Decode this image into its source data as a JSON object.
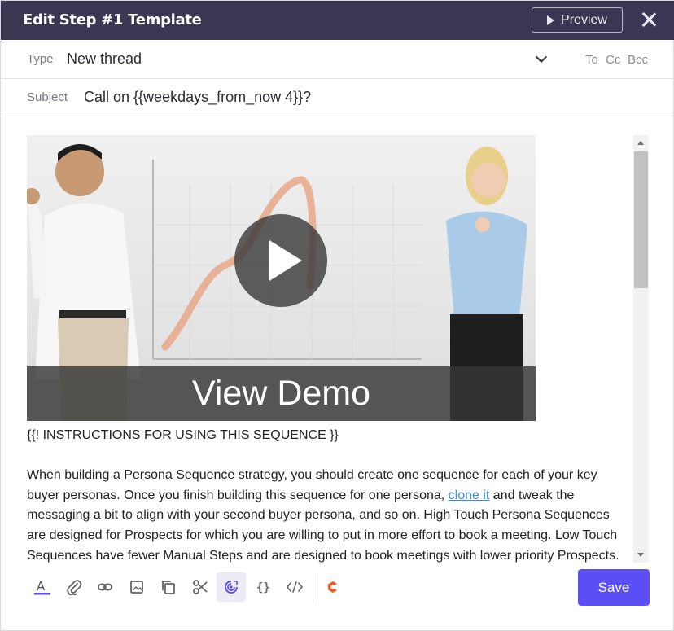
{
  "header": {
    "title": "Edit Step #1 Template",
    "preview_label": "Preview"
  },
  "type_row": {
    "label": "Type",
    "value": "New thread",
    "recipients": {
      "to": "To",
      "cc": "Cc",
      "bcc": "Bcc"
    }
  },
  "subject_row": {
    "label": "Subject",
    "value": "Call on {{weekdays_from_now 4}}?"
  },
  "editor": {
    "video": {
      "caption": "View Demo"
    },
    "instructions_heading": "{{! INSTRUCTIONS FOR USING THIS SEQUENCE }}",
    "paragraph_before_link": "When building a Persona Sequence strategy, you should create one sequence for each of your key buyer personas. Once you finish building this sequence for one persona, ",
    "link_text": "clone it",
    "paragraph_after_link": " and tweak the messaging a bit to align with your second buyer persona, and so on. High Touch Persona Sequences are designed for Prospects for which you are willing to put in more effort to book a meeting. Low Touch Sequences have fewer Manual Steps and are designed to book meetings with lower priority Prospects."
  },
  "toolbar": {
    "icons": [
      "text-color-icon",
      "attachment-icon",
      "link-icon",
      "image-icon",
      "copy-icon",
      "cut-icon",
      "track-icon",
      "variables-icon",
      "code-icon",
      "brand-icon"
    ],
    "save_label": "Save"
  },
  "colors": {
    "header_bg": "#3b3652",
    "accent": "#5a4ef4",
    "brand_icon": "#f05a28",
    "link": "#3d8fd8"
  }
}
